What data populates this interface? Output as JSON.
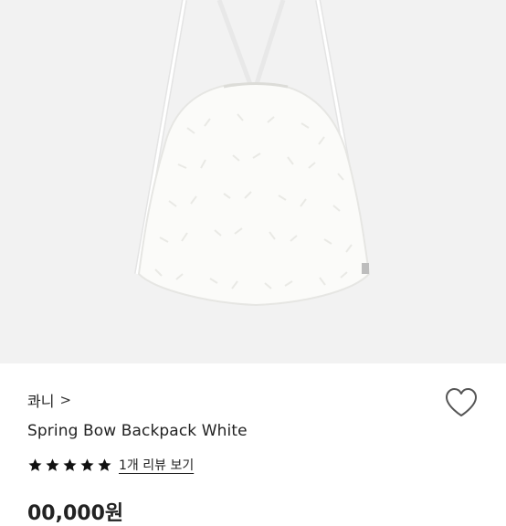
{
  "product": {
    "image_alt": "Spring Bow Backpack White",
    "brand": "콰니",
    "brand_chevron": ">",
    "title": "Spring Bow Backpack White",
    "rating": 5,
    "max_rating": 5,
    "review_link": "1개 리뷰 보기",
    "price": "00,000원"
  },
  "colors": {
    "image_bg": "#f2f2f2",
    "star": "#111111",
    "heart_outline": "#555555"
  },
  "icons": {
    "wishlist": "heart-outline-icon",
    "star": "star-filled-icon",
    "brand_chevron": "chevron-right-icon"
  }
}
